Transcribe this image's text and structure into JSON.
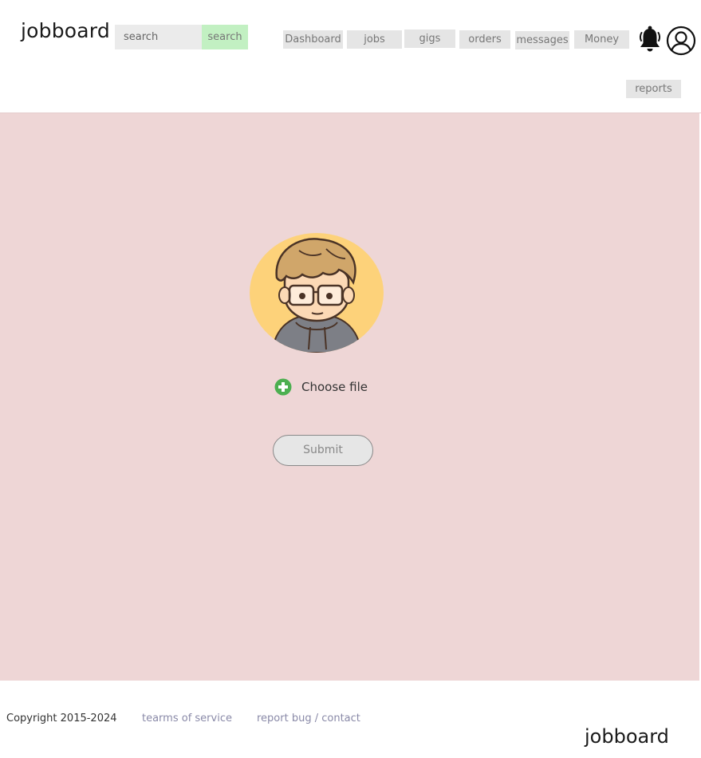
{
  "header": {
    "logo": "jobboard",
    "search": {
      "placeholder": "search",
      "value": "",
      "button_label": "search"
    },
    "nav": [
      "Dashboard",
      "jobs",
      "gigs",
      "orders",
      "messages",
      "Money",
      "reports"
    ],
    "icons": {
      "notifications": "bell-icon",
      "account": "user-circle-icon"
    }
  },
  "upload": {
    "image": "cartoon boy with glasses avatar",
    "choose_label": "Choose file",
    "choose_icon": "plus-circle-icon",
    "submit_label": "Submit"
  },
  "footer": {
    "copyright": "Copyright 2015-2024",
    "terms": "tearms of service",
    "report": "report bug / contact",
    "logo": "jobboard"
  },
  "colors": {
    "main_background": "#eed6d6",
    "search_button": "#c2f0c2",
    "nav_button": "#e5e5e5",
    "plus_icon": "#4caf50",
    "link": "#8a8aa8"
  }
}
